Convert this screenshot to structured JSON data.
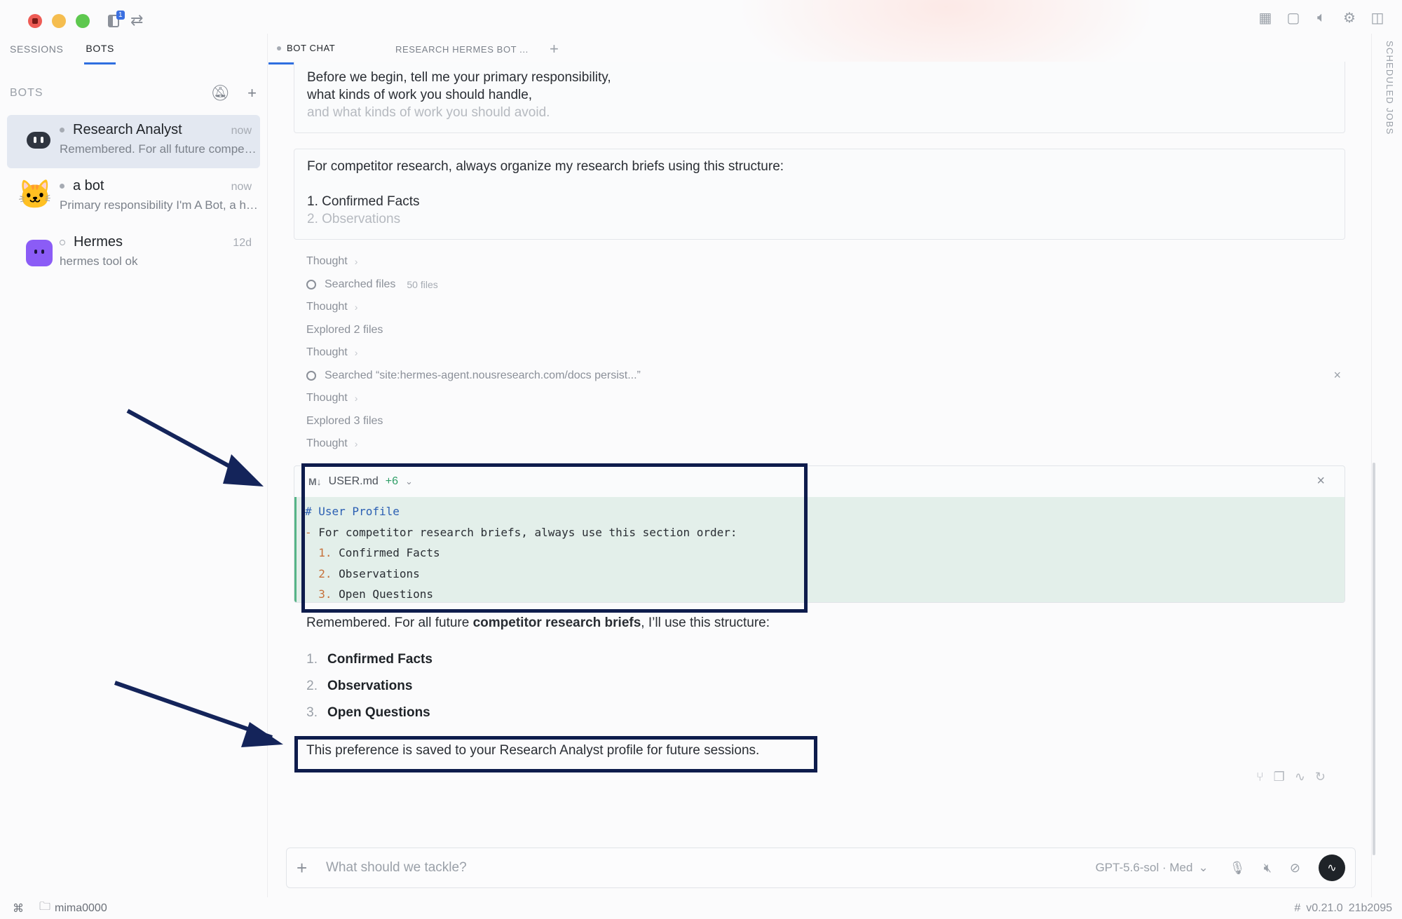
{
  "sidebar": {
    "tabs": [
      {
        "label": "SESSIONS",
        "active": false
      },
      {
        "label": "BOTS",
        "active": true
      }
    ],
    "section_title": "BOTS",
    "bots": [
      {
        "name": "Research Analyst",
        "time": "now",
        "preview": "Remembered. For all future competitor research briefs, I'll use this structure",
        "avatar": "robot-face-icon",
        "active": true
      },
      {
        "name": "a bot",
        "time": "now",
        "preview": "Primary responsibility I'm A Bot, a helpful assistant",
        "avatar": "cat-avatar-icon",
        "active": false
      },
      {
        "name": "Hermes",
        "time": "12d",
        "preview": "hermes tool ok",
        "avatar": "purple-bot-icon",
        "active": false
      }
    ]
  },
  "main_tabs": [
    {
      "label": "BOT CHAT",
      "active": true
    },
    {
      "label": "RESEARCH HERMES BOT ...",
      "active": false
    }
  ],
  "rail": {
    "label": "SCHEDULED JOBS"
  },
  "messages": {
    "card1": {
      "line1": "Before we begin, tell me your primary responsibility,",
      "line2": "what kinds of work you should handle,",
      "line3": "and what kinds of work you should avoid."
    },
    "card2": {
      "line1": "For competitor research, always organize my research briefs using this structure:",
      "line2": "1. Confirmed Facts",
      "line3": "2. Observations"
    }
  },
  "activity": [
    {
      "label": "Thought",
      "type": "thought"
    },
    {
      "label": "Searched files",
      "detail": "50 files",
      "type": "search"
    },
    {
      "label": "Thought",
      "type": "thought"
    },
    {
      "label": "Explored 2 files",
      "type": "plain"
    },
    {
      "label": "Thought",
      "type": "thought"
    },
    {
      "label": "Searched “site:hermes-agent.nousresearch.com/docs persist...”",
      "type": "search-x"
    },
    {
      "label": "Thought",
      "type": "thought"
    },
    {
      "label": "Explored 3 files",
      "type": "plain"
    },
    {
      "label": "Thought",
      "type": "thought"
    }
  ],
  "diff": {
    "md_label": "M↓",
    "file": "USER.md",
    "changes": "+6",
    "lines": {
      "heading": "# User Profile",
      "bullet_dash": "-",
      "bullet": "For competitor research briefs, always use this section order:",
      "items": [
        {
          "n": "1.",
          "text": "Confirmed Facts"
        },
        {
          "n": "2.",
          "text": "Observations"
        },
        {
          "n": "3.",
          "text": "Open Questions"
        }
      ]
    }
  },
  "reply": {
    "lead_pre": "Remembered. For all future ",
    "lead_bold": "competitor research briefs",
    "lead_post": ", I’ll use this structure:",
    "items": [
      {
        "n": "1.",
        "text": "Confirmed Facts"
      },
      {
        "n": "2.",
        "text": "Observations"
      },
      {
        "n": "3.",
        "text": "Open Questions"
      }
    ],
    "final": "This preference is saved to your Research Analyst profile for future sessions."
  },
  "composer": {
    "placeholder": "What should we tackle?",
    "model": "GPT-5.6-sol · Med"
  },
  "statusbar": {
    "cmd": "⌘",
    "folder": "mima0000",
    "version": "v0.21.0",
    "build": "21b2095",
    "hash": "#"
  },
  "colors": {
    "accent": "#2f6fe0",
    "highlight_box": "#0e1c4c",
    "diff_bg": "#e3efea",
    "diff_add": "#2f9e67"
  }
}
